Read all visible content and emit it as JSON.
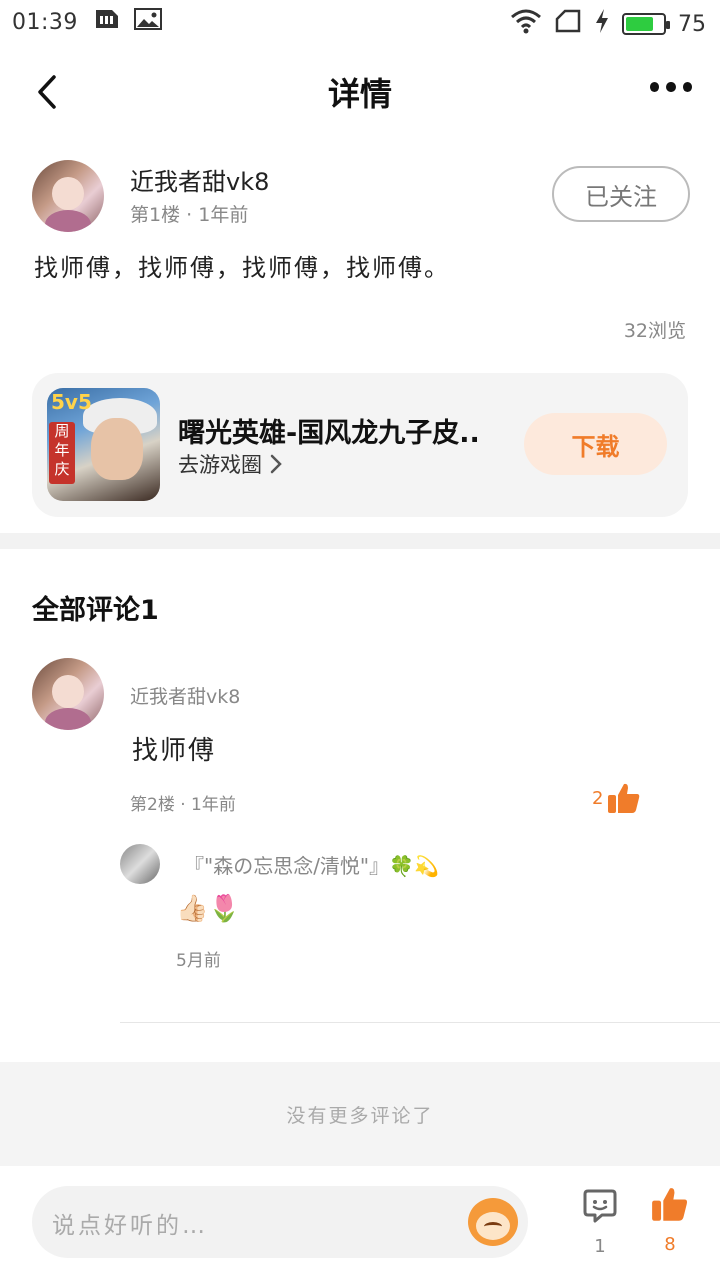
{
  "status_bar": {
    "time": "01:39",
    "battery": "75",
    "battery_level": 0.75
  },
  "header": {
    "title": "详情"
  },
  "post": {
    "author": "近我者甜vk8",
    "floor": "第1楼",
    "time": "1年前",
    "follow_label": "已关注",
    "text": "找师傅，找师傅，找师傅，找师傅。",
    "views": "32浏览"
  },
  "game_card": {
    "badge": "5v5",
    "tag": "周年庆",
    "title": "曙光英雄-国风龙九子皮..",
    "link_label": "去游戏圈",
    "download_label": "下载"
  },
  "comments": {
    "title": "全部评论1",
    "items": [
      {
        "author": "近我者甜vk8",
        "text": "找师傅",
        "floor": "第2楼",
        "time": "1年前",
        "likes": "2",
        "reply": {
          "author": "『\"森の忘思念/清悦\"』🍀💫",
          "text": "👍🏻🌷",
          "time": "5月前"
        }
      }
    ],
    "no_more": "没有更多评论了"
  },
  "bottom_bar": {
    "input_placeholder": "说点好听的…",
    "comment_count": "1",
    "like_count": "8"
  },
  "colors": {
    "accent": "#f07c2a",
    "battery": "#2ecc40"
  }
}
